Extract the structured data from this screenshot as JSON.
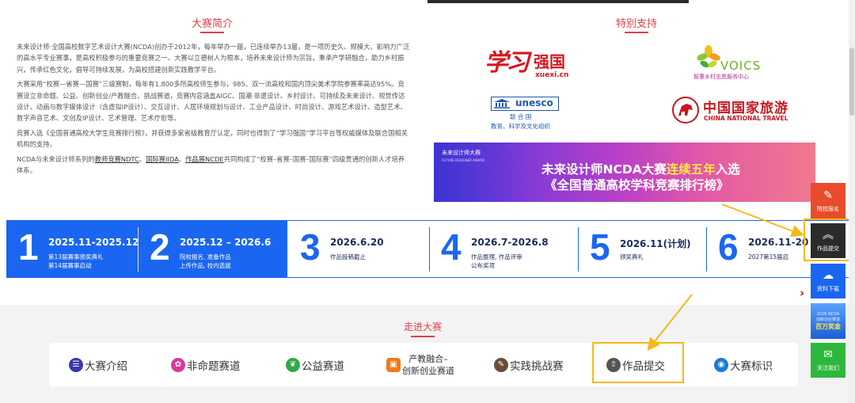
{
  "intro": {
    "title": "大赛简介",
    "p1": "未来设计师·全国高校数字艺术设计大赛(NCDA)创办于2012年，每年举办一届，已连续举办13届，是一项历史久、规模大、影响力广泛的高水平专业赛事，是高校积极参与的重要竞赛之一。大赛以立德树人为根本，培养未来设计师为宗旨，秉承产学研融合，助力乡村振兴，传承红色文化，倡导可持续发展，为高校搭建创新实践教学平台。",
    "p2": "大赛采用“校赛—省赛—国赛”三级赛制，每年有1,800多所高校师生参与，985、双一流高校和国内顶尖美术学院参赛率高达95%。竞赛设立非命题、公益、创新创业/产教融合、挑战赛道，竞赛内容涵盖AIGC、国潮·非遗设计、乡村设计、可持续及未来设计、视觉传达设计、动画与数字媒体设计（含虚拟IP设计）、交互设计、人居环境规划与设计、工业产品设计、时尚设计、游戏艺术设计、造型艺术、数字声音艺术、文创及IP设计、艺术管理、艺术疗愈等。",
    "p3": "竞赛入选《全国普通高校大学生竞赛排行榜》，并获得多家省级教育厅认定，同时也得到了“学习强国”学习平台等权威媒体及联合国相关机构的支持。",
    "p4_pre": "NCDA与未来设计师系列的",
    "link1": "教师竞赛NDTC",
    "sep1": "、",
    "link2": "国际赛IIDA",
    "sep2": "、",
    "link3": "作品展NCDE",
    "p4_post": "共同构成了“校赛–省赛–国赛–国际赛”四级贯通的创新人才培养体系。"
  },
  "support": {
    "title": "特别支持",
    "xxqg": {
      "calli": "学习",
      "word": "强国",
      "url": "xuexi.cn"
    },
    "voices": {
      "word": "VOICS",
      "sub": "智惠乡村志愿服务中心"
    },
    "unesco": {
      "word": "unesco",
      "cn1": "联 合 国",
      "cn2": "教育、科学及文化组织"
    },
    "cnta": {
      "word": "中国国家旅游",
      "en": "CHINA NATIONAL TRAVEL"
    }
  },
  "banner": {
    "logo": "未来设计师大赛",
    "logo_sub": "FUTURE DESIGNER AWARD",
    "line1_pre": "未来设计师NCDA大赛",
    "line1_hl": "连续五年",
    "line1_post": "入选",
    "line2": "《全国普通高校学科竞赛排行榜》"
  },
  "timeline": [
    {
      "num": "1",
      "date": "2025.11-2025.12",
      "desc1": "第13届赛事颁奖典礼",
      "desc2": "第14届赛事启动",
      "active": true
    },
    {
      "num": "2",
      "date": "2025.12 – 2026.6",
      "desc1": "院校报名, 准备作品",
      "desc2": "上传作品, 校内选拔",
      "active": true
    },
    {
      "num": "3",
      "date": "2026.6.20",
      "desc1": "作品投稿截止",
      "desc2": "",
      "active": false
    },
    {
      "num": "4",
      "date": "2026.7-2026.8",
      "desc1": "作品整理, 作品评审",
      "desc2": "公布奖项",
      "active": false
    },
    {
      "num": "5",
      "date": "2026.11(计划)",
      "desc1": "颁奖典礼",
      "desc2": "",
      "active": false
    },
    {
      "num": "6",
      "date": "2026.11-20",
      "desc1": "2027第15届启",
      "desc2": "",
      "active": false
    }
  ],
  "bottom": {
    "title": "走进大赛",
    "nav": [
      {
        "label": "大赛介绍",
        "icon": "document-icon",
        "color": "#3a3aa8"
      },
      {
        "label": "非命题赛道",
        "icon": "palette-icon",
        "color": "#d83a9a"
      },
      {
        "label": "公益赛道",
        "icon": "leaf-icon",
        "color": "#2fa84a"
      },
      {
        "label_l1": "产教融合–",
        "label_l2": "创新创业赛道",
        "icon": "briefcase-icon",
        "color": "#f07a1a"
      },
      {
        "label": "实践挑战赛",
        "icon": "wrench-icon",
        "color": "#6a4a3a"
      },
      {
        "label": "作品提交",
        "icon": "upload-icon",
        "color": "#555555"
      },
      {
        "label": "大赛标识",
        "icon": "eye-icon",
        "color": "#1a7ad8"
      }
    ]
  },
  "float": {
    "signup": "院校报名",
    "submit": "作品提交",
    "download": "资料下载",
    "promo_1": "2026 NCDA",
    "promo_2": "创新创业赛道",
    "promo_3": "百万奖金",
    "follow": "关注我们"
  },
  "colors": {
    "accent_blue": "#1a66f0",
    "title_red": "#e0404a",
    "highlight": "#f5b915"
  }
}
